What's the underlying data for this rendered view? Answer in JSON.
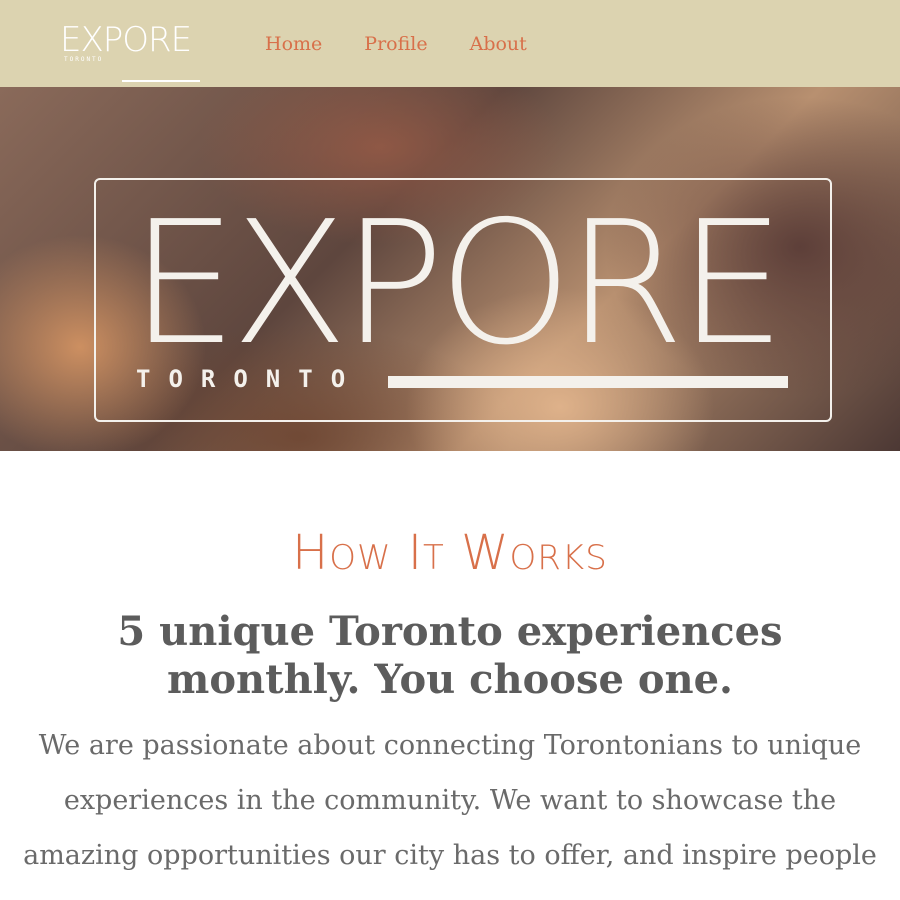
{
  "header": {
    "brand": {
      "word": "EXPORE",
      "sub": "TORONTO"
    },
    "nav": [
      "Home",
      "Profile",
      "About"
    ]
  },
  "hero": {
    "word": "EXPORE",
    "city": "TORONTO"
  },
  "content": {
    "title": "How It Works",
    "subhead": "5 unique Toronto experiences monthly. You choose one.",
    "body": "We are passionate about connecting Torontonians to unique experiences in the community. We want to showcase the amazing opportunities our city has to offer, and inspire people to"
  },
  "colors": {
    "topbar": "#dcd3b0",
    "accent": "#d8704a",
    "text": "#5c5c5c"
  }
}
